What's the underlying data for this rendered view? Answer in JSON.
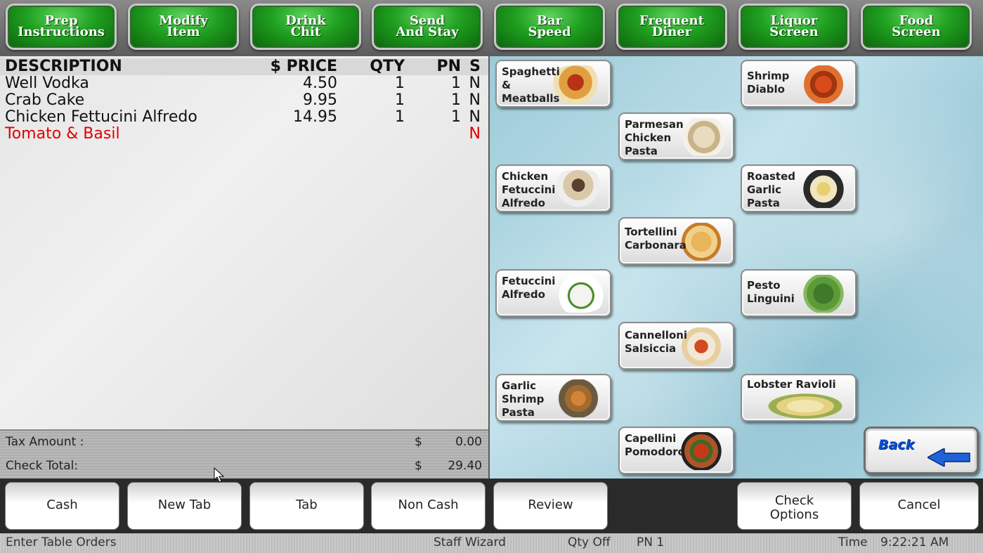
{
  "toolbar": {
    "buttons": [
      {
        "label": "Prep\nInstructions"
      },
      {
        "label": "Modify\nItem"
      },
      {
        "label": "Drink\nChit"
      },
      {
        "label": "Send\nAnd Stay"
      },
      {
        "label": "Bar\nSpeed"
      },
      {
        "label": "Frequent\nDiner"
      },
      {
        "label": "Liquor\nScreen"
      },
      {
        "label": "Food\nScreen"
      }
    ]
  },
  "order": {
    "headers": {
      "description": "DESCRIPTION",
      "price": "$ PRICE",
      "qty": "QTY",
      "pn": "PN",
      "s": "S"
    },
    "rows": [
      {
        "description": "Well Vodka",
        "price": "4.50",
        "qty": "1",
        "pn": "1",
        "s": "N"
      },
      {
        "description": "Crab Cake",
        "price": "9.95",
        "qty": "1",
        "pn": "1",
        "s": "N"
      },
      {
        "description": "Chicken Fettucini Alfredo",
        "price": "14.95",
        "qty": "1",
        "pn": "1",
        "s": "N"
      },
      {
        "description": "Tomato & Basil",
        "price": "",
        "qty": "",
        "pn": "",
        "s": "N"
      }
    ]
  },
  "totals": {
    "tax_label": "Tax Amount :",
    "tax_currency": "$",
    "tax_value": "0.00",
    "total_label": "Check Total:",
    "total_currency": "$",
    "total_value": "29.40"
  },
  "menu_items": [
    {
      "label": "Spaghetti &\nMeatballs"
    },
    {
      "label": "Shrimp\nDiablo"
    },
    {
      "label": "Parmesan\nChicken\nPasta"
    },
    {
      "label": "Chicken\nFetuccini\nAlfredo"
    },
    {
      "label": "Roasted\nGarlic\nPasta"
    },
    {
      "label": "Tortellini\nCarbonara"
    },
    {
      "label": "Fetuccini\nAlfredo"
    },
    {
      "label": "Pesto\nLinguini"
    },
    {
      "label": "Cannelloni\nSalsiccia"
    },
    {
      "label": "Garlic\nShrimp\nPasta"
    },
    {
      "label": "Lobster Ravioli"
    },
    {
      "label": "Capellini\nPomodoro"
    }
  ],
  "back_label": "Back",
  "back_arrow_color": "#1e63d8",
  "bottom_buttons": [
    {
      "label": "Cash"
    },
    {
      "label": "New Tab"
    },
    {
      "label": "Tab"
    },
    {
      "label": "Non Cash"
    },
    {
      "label": "Review"
    },
    {
      "label": "Check\nOptions"
    },
    {
      "label": "Cancel"
    }
  ],
  "status": {
    "prompt": "Enter Table Orders",
    "staff": "Staff Wizard",
    "qty_mode": "Qty Off",
    "pn": "PN 1",
    "time_label": "Time",
    "time": "9:22:21 AM"
  },
  "colors": {
    "toolbar_green": "#20a020",
    "modifier_red": "#e00000",
    "back_blue": "#0a4fd0"
  }
}
